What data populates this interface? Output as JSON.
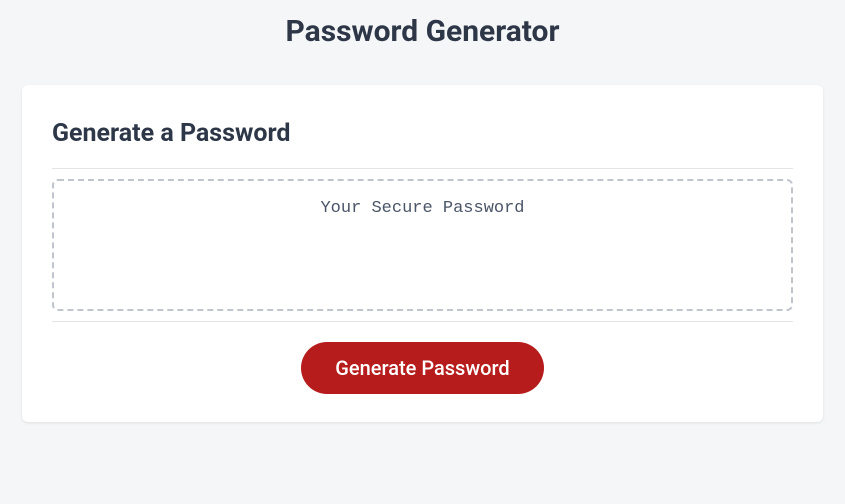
{
  "header": {
    "title": "Password Generator"
  },
  "card": {
    "title": "Generate a Password",
    "placeholder": "Your Secure Password",
    "button_label": "Generate Password"
  }
}
